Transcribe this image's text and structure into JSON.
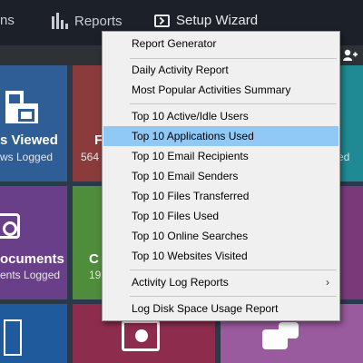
{
  "topbar": {
    "partial_item": "ns",
    "reports_label": "Reports",
    "setup_label": "Setup Wizard"
  },
  "tiles": {
    "t1_title": "s Viewed",
    "t1_sub": "ws Logged",
    "t2_title": "F",
    "t2_sub": "564",
    "t3_sub": "ed",
    "t4_title": "ocuments",
    "t4_sub": "ents Logged",
    "t5_title": "C",
    "t5_sub": "19"
  },
  "menu": {
    "items": [
      {
        "label": "Report Generator"
      },
      {
        "label": "Daily Activity Report"
      },
      {
        "label": "Most Popular Activities Summary"
      },
      {
        "label": "Top 10 Active/Idle Users"
      },
      {
        "label": "Top 10 Applications Used"
      },
      {
        "label": "Top 10 Email Recipients"
      },
      {
        "label": "Top 10 Email Senders"
      },
      {
        "label": "Top 10 Files Transferred"
      },
      {
        "label": "Top 10 Files Used"
      },
      {
        "label": "Top 10 Online Searches"
      },
      {
        "label": "Top 10 Websites Visited"
      },
      {
        "label": "Activity Log Reports"
      },
      {
        "label": "Log Disk Space Usage Report"
      }
    ],
    "highlighted": "Top 10 Applications Used",
    "submenu_arrow": "›"
  },
  "colors": {
    "highlight": "#90c8f6",
    "menu_bg": "#f0f0f0",
    "topbar_bg": "#1c2028"
  }
}
